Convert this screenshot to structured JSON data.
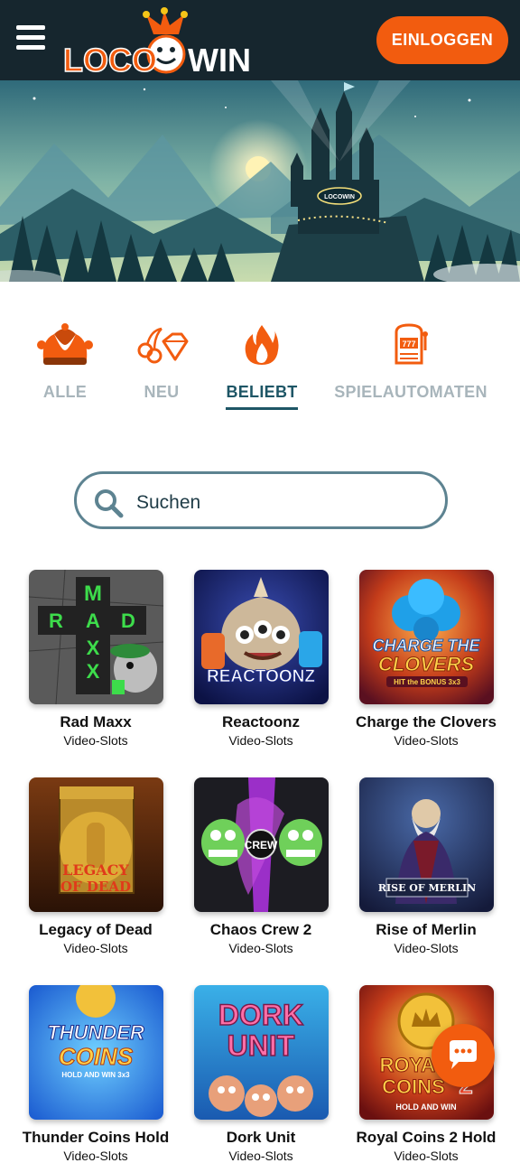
{
  "header": {
    "logo_text_left": "LOCO",
    "logo_text_right": "WIN",
    "login_label": "EINLOGGEN"
  },
  "hero": {
    "sign_text": "LOCOWIN"
  },
  "tabs": [
    {
      "label": "ALLE",
      "icon": "jester-hat-icon",
      "active": false
    },
    {
      "label": "NEU",
      "icon": "cherry-diamond-icon",
      "active": false
    },
    {
      "label": "BELIEBT",
      "icon": "flame-icon",
      "active": true
    },
    {
      "label": "SPIELAUTOMATEN",
      "icon": "slot-machine-icon",
      "active": false
    }
  ],
  "search": {
    "placeholder": "Suchen"
  },
  "games": [
    {
      "title": "Rad Maxx",
      "category": "Video-Slots",
      "thumb_text": "RAD MAXX"
    },
    {
      "title": "Reactoonz",
      "category": "Video-Slots",
      "thumb_text": "REACTOONZ"
    },
    {
      "title": "Charge the Clovers",
      "category": "Video-Slots",
      "thumb_text": "CHARGE THE CLOVERS"
    },
    {
      "title": "Legacy of Dead",
      "category": "Video-Slots",
      "thumb_text": "LEGACY OF DEAD"
    },
    {
      "title": "Chaos Crew 2",
      "category": "Video-Slots",
      "thumb_text": "CREW"
    },
    {
      "title": "Rise of Merlin",
      "category": "Video-Slots",
      "thumb_text": "RISE OF MERLIN"
    },
    {
      "title": "Thunder Coins Hold",
      "category": "Video-Slots",
      "thumb_text": "THUNDER COINS"
    },
    {
      "title": "Dork Unit",
      "category": "Video-Slots",
      "thumb_text": "DORK UNIT"
    },
    {
      "title": "Royal Coins 2 Hold",
      "category": "Video-Slots",
      "thumb_text": "ROYAL COINS 2"
    }
  ],
  "colors": {
    "header_bg": "#16262e",
    "accent": "#f25c0f",
    "tab_active": "#1e5666",
    "tab_inactive": "#a8b5bb"
  }
}
